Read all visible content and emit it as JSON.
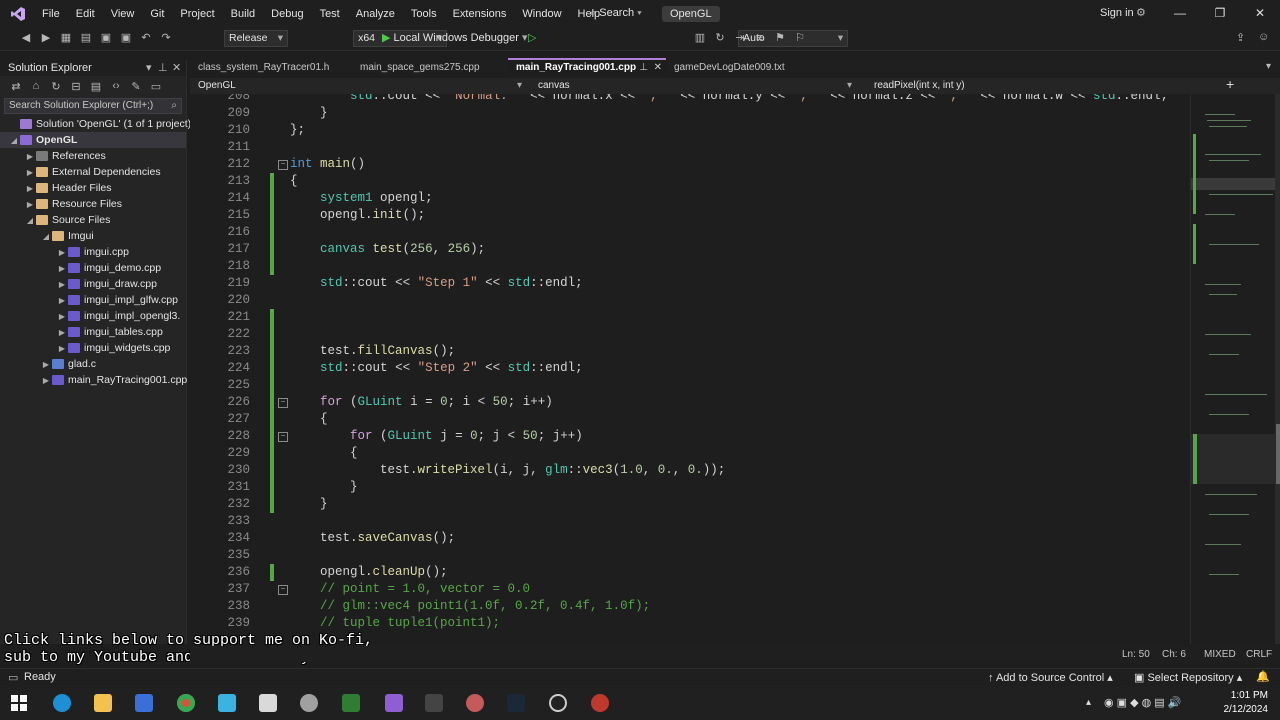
{
  "titlebar": {
    "menu": [
      "File",
      "Edit",
      "View",
      "Git",
      "Project",
      "Build",
      "Debug",
      "Test",
      "Analyze",
      "Tools",
      "Extensions",
      "Window",
      "Help"
    ],
    "search_label": "Search",
    "solution_name": "OpenGL",
    "signin": "Sign in"
  },
  "toolbar": {
    "config": "Release",
    "platform": "x64",
    "debugger": "Local Windows Debugger",
    "auto": "Auto"
  },
  "solution_explorer": {
    "title": "Solution Explorer",
    "search_placeholder": "Search Solution Explorer (Ctrl+;)",
    "items": [
      {
        "label": "Solution 'OpenGL' (1 of 1 project)"
      },
      {
        "label": "OpenGL"
      },
      {
        "label": "References"
      },
      {
        "label": "External Dependencies"
      },
      {
        "label": "Header Files"
      },
      {
        "label": "Resource Files"
      },
      {
        "label": "Source Files"
      },
      {
        "label": "Imgui"
      },
      {
        "label": "imgui.cpp"
      },
      {
        "label": "imgui_demo.cpp"
      },
      {
        "label": "imgui_draw.cpp"
      },
      {
        "label": "imgui_impl_glfw.cpp"
      },
      {
        "label": "imgui_impl_opengl3."
      },
      {
        "label": "imgui_tables.cpp"
      },
      {
        "label": "imgui_widgets.cpp"
      },
      {
        "label": "glad.c"
      },
      {
        "label": "main_RayTracing001.cpp"
      }
    ]
  },
  "tabs": [
    {
      "label": "class_system_RayTracer01.h"
    },
    {
      "label": "main_space_gems275.cpp"
    },
    {
      "label": "main_RayTracing001.cpp"
    },
    {
      "label": "gameDevLogDate009.txt"
    }
  ],
  "navbar": {
    "project": "OpenGL",
    "scope": "canvas",
    "member": "readPixel(int x, int y)"
  },
  "editor": {
    "lines": [
      {
        "n": "208",
        "code": "        std::cout << \"Normal: \" << normal.x << \", \" << normal.y << \", \" << normal.z << \", \" << normal.w << std::endl;"
      },
      {
        "n": "209",
        "code": "    }"
      },
      {
        "n": "210",
        "code": "};"
      },
      {
        "n": "211",
        "code": ""
      },
      {
        "n": "212",
        "code": "int main()"
      },
      {
        "n": "213",
        "code": "{"
      },
      {
        "n": "214",
        "code": "    system1 opengl;"
      },
      {
        "n": "215",
        "code": "    opengl.init();"
      },
      {
        "n": "216",
        "code": ""
      },
      {
        "n": "217",
        "code": "    canvas test(256, 256);"
      },
      {
        "n": "218",
        "code": ""
      },
      {
        "n": "219",
        "code": "    std::cout << \"Step 1\" << std::endl;"
      },
      {
        "n": "220",
        "code": ""
      },
      {
        "n": "221",
        "code": ""
      },
      {
        "n": "222",
        "code": ""
      },
      {
        "n": "223",
        "code": "    test.fillCanvas();"
      },
      {
        "n": "224",
        "code": "    std::cout << \"Step 2\" << std::endl;"
      },
      {
        "n": "225",
        "code": ""
      },
      {
        "n": "226",
        "code": "    for (GLuint i = 0; i < 50; i++)"
      },
      {
        "n": "227",
        "code": "    {"
      },
      {
        "n": "228",
        "code": "        for (GLuint j = 0; j < 50; j++)"
      },
      {
        "n": "229",
        "code": "        {"
      },
      {
        "n": "230",
        "code": "            test.writePixel(i, j, glm::vec3(1.0, 0., 0.));"
      },
      {
        "n": "231",
        "code": "        }"
      },
      {
        "n": "232",
        "code": "    }"
      },
      {
        "n": "233",
        "code": ""
      },
      {
        "n": "234",
        "code": "    test.saveCanvas();"
      },
      {
        "n": "235",
        "code": ""
      },
      {
        "n": "236",
        "code": "    opengl.cleanUp();"
      },
      {
        "n": "237",
        "code": "    // point = 1.0, vector = 0.0"
      },
      {
        "n": "238",
        "code": "    // glm::vec4 point1(1.0f, 0.2f, 0.4f, 1.0f);"
      },
      {
        "n": "239",
        "code": "    // tuple tuple1(point1);"
      }
    ]
  },
  "overlay": {
    "line1": "Click links below to support me on Ko-fi,",
    "line2": "sub to my Youtube and check out my free demo on Itch!"
  },
  "editor_status": {
    "ln": "Ln: 50",
    "ch": "Ch: 6",
    "mode": "MIXED",
    "eol": "CRLF"
  },
  "statusbar": {
    "ready": "Ready",
    "source_control": "Add to Source Control",
    "repository": "Select Repository"
  },
  "taskbar": {
    "time": "1:01 PM",
    "date": "2/12/2024"
  },
  "colors": {
    "accent": "#b180d7",
    "editor_bg": "#1e1e1e",
    "change_bar": "#57a64a"
  }
}
